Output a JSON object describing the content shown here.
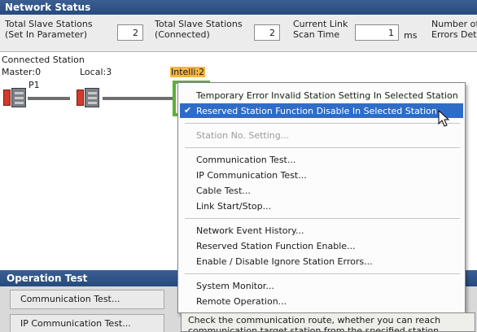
{
  "network_status": {
    "title": "Network Status",
    "total_slave_set": {
      "label1": "Total Slave Stations",
      "label2": "(Set In Parameter)",
      "value": "2"
    },
    "total_slave_connected": {
      "label1": "Total Slave Stations",
      "label2": "(Connected)",
      "value": "2"
    },
    "link_scan_time": {
      "label1": "Current Link",
      "label2": "Scan Time",
      "value": "1",
      "unit": "ms"
    },
    "errors": {
      "label1": "Number of",
      "label2": "Errors Dete"
    }
  },
  "connected_station": {
    "caption": "Connected Station",
    "master_label": "Master:0",
    "local_label": "Local:3",
    "intelli_label": "Intelli:2",
    "p1_label": "P1"
  },
  "operation_test": {
    "title": "Operation Test",
    "buttons": [
      "Communication Test...",
      "IP Communication Test..."
    ]
  },
  "context_menu": {
    "group1": [
      "Temporary Error Invalid Station Setting In Selected Station",
      "Reserved Station Function Disable In Selected Station"
    ],
    "selected_index": 1,
    "group2": [
      "Station No. Setting..."
    ],
    "group3": [
      "Communication Test...",
      "IP Communication Test...",
      "Cable Test...",
      "Link Start/Stop..."
    ],
    "group4": [
      "Network Event History...",
      "Reserved Station Function Enable...",
      "Enable / Disable Ignore Station Errors..."
    ],
    "group5": [
      "System Monitor...",
      "Remote Operation..."
    ]
  },
  "tooltip": {
    "line1": "Check the communication route, whether you can reach",
    "line2": "communication target station from the specified station."
  },
  "colors": {
    "header": "#264a7c",
    "selection": "#2f6cc8",
    "intelli_highlight": "#f4b93b",
    "intelli_frame": "#5cb132",
    "plc_red": "#d23a2c"
  }
}
